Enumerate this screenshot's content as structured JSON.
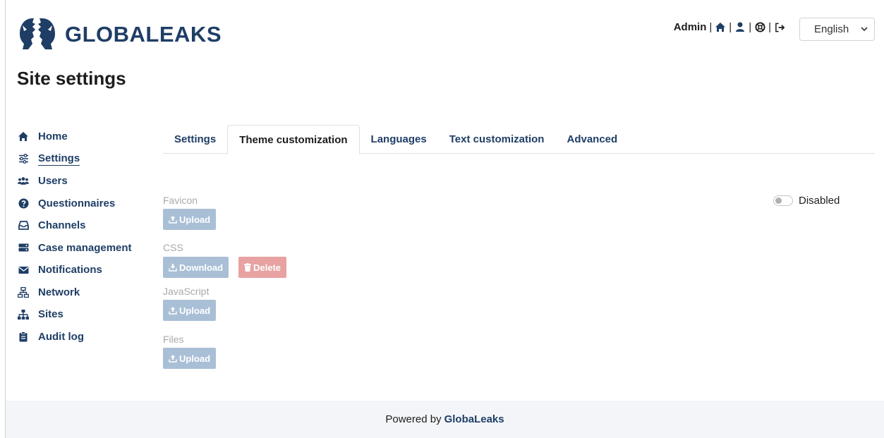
{
  "brand": {
    "logo_text": "GLOBALEAKS",
    "logo_icon": "globaleaks-faces-logo"
  },
  "topbar": {
    "user": "Admin",
    "separator": "|",
    "icons": [
      "home-icon",
      "user-icon",
      "lifebuoy-icon",
      "logout-icon"
    ]
  },
  "language_select": {
    "selected": "English"
  },
  "page": {
    "title": "Site settings"
  },
  "sidebar": {
    "items": [
      {
        "label": "Home",
        "icon": "home-icon"
      },
      {
        "label": "Settings",
        "icon": "sliders-icon",
        "active": true
      },
      {
        "label": "Users",
        "icon": "users-icon"
      },
      {
        "label": "Questionnaires",
        "icon": "question-circle-icon"
      },
      {
        "label": "Channels",
        "icon": "inbox-icon"
      },
      {
        "label": "Case management",
        "icon": "storage-icon"
      },
      {
        "label": "Notifications",
        "icon": "envelope-icon"
      },
      {
        "label": "Network",
        "icon": "network-icon"
      },
      {
        "label": "Sites",
        "icon": "sitemap-icon"
      },
      {
        "label": "Audit log",
        "icon": "clipboard-icon"
      }
    ]
  },
  "tabs": [
    {
      "label": "Settings"
    },
    {
      "label": "Theme customization",
      "active": true
    },
    {
      "label": "Languages"
    },
    {
      "label": "Text customization"
    },
    {
      "label": "Advanced"
    }
  ],
  "theme": {
    "favicon_label": "Favicon",
    "css_label": "CSS",
    "javascript_label": "JavaScript",
    "files_label": "Files",
    "upload_label": "Upload",
    "download_label": "Download",
    "delete_label": "Delete",
    "toggle_label": "Disabled",
    "toggle_state": false
  },
  "footer": {
    "prefix": "Powered by",
    "brand": "GlobaLeaks"
  },
  "colors": {
    "brand": "#1f3e66",
    "primary_disabled": "#a9bfd6",
    "danger_disabled": "#e8a2a2",
    "footer_bg": "#f3f5f8"
  }
}
